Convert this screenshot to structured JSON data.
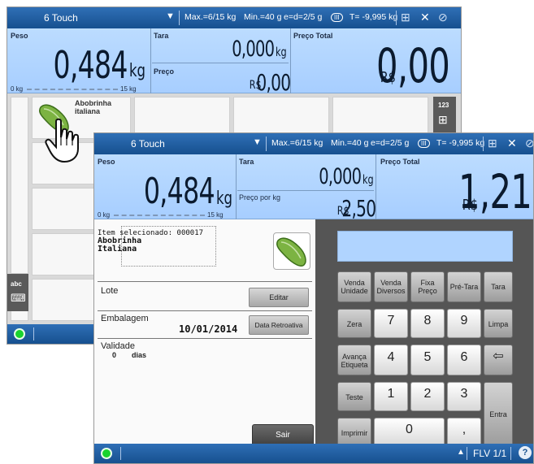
{
  "back_window": {
    "title": "6 Touch",
    "dropdown": "▼",
    "max": "Max.=6/15 kg",
    "min": "Min.=40 g",
    "e_d": "e=d=2/5 g",
    "class": "III",
    "tare_info": "T= -9,995 kg",
    "peso_label": "Peso",
    "peso_value": "0,484",
    "peso_unit": "kg",
    "scale_min": "0 kg",
    "scale_max": "15 kg",
    "tara_label": "Tara",
    "tara_value": "0,000",
    "tara_unit": "kg",
    "preco_label": "Preço",
    "preco_currency": "R$",
    "preco_value": "0,00",
    "preco_total_label": "Preço Total",
    "total_currency": "R$",
    "total_value": "0,00",
    "item_name": "Abobrinha italiana",
    "numeric_mode": "123",
    "alpha_mode": "abc"
  },
  "front_window": {
    "title": "6 Touch",
    "dropdown": "▼",
    "max": "Max.=6/15 kg",
    "min": "Min.=40 g",
    "e_d": "e=d=2/5 g",
    "class": "III",
    "tare_info": "T= -9,995 kg",
    "peso_label": "Peso",
    "peso_value": "0,484",
    "peso_unit": "kg",
    "scale_min": "0 kg",
    "scale_max": "15 kg",
    "tara_label": "Tara",
    "tara_value": "0,000",
    "tara_unit": "kg",
    "preco_kg_label": "Preço por kg",
    "preco_currency": "R$",
    "preco_value": "2,50",
    "preco_total_label": "Preço Total",
    "total_currency": "R$",
    "total_value": "1,21",
    "item_selected_label": "Item selecionado: 000017",
    "item_line1": "Abobrinha",
    "item_line2": "Italiana",
    "lote_label": "Lote",
    "editar_button": "Editar",
    "embalagem_label": "Embalagem",
    "embalagem_date": "10/01/2014",
    "data_retroativa_button": "Data Retroativa",
    "validade_label": "Validade",
    "validade_value": "0",
    "validade_unit": "dias",
    "sair_button": "Sair",
    "status_text": "FLV 1/1",
    "keys": {
      "venda_unidade": [
        "Venda",
        "Unidade"
      ],
      "venda_diversos": [
        "Venda",
        "Diversos"
      ],
      "fixa_preco": [
        "Fixa",
        "Preço"
      ],
      "pre_tara": "Pré-Tara",
      "tara": "Tara",
      "zera": "Zera",
      "limpa": "Limpa",
      "avanca_etiqueta": [
        "Avança",
        "Etiqueta"
      ],
      "teste": "Teste",
      "imprimir": "Imprimir",
      "entra": "Entra",
      "n7": "7",
      "n8": "8",
      "n9": "9",
      "n4": "4",
      "n5": "5",
      "n6": "6",
      "n1": "1",
      "n2": "2",
      "n3": "3",
      "n0": "0",
      "comma": ","
    }
  },
  "colors": {
    "titlebar": "#1f5fa6",
    "display": "#b3d6ff",
    "keypad_bg": "#555555",
    "status_led": "#19d32e"
  }
}
